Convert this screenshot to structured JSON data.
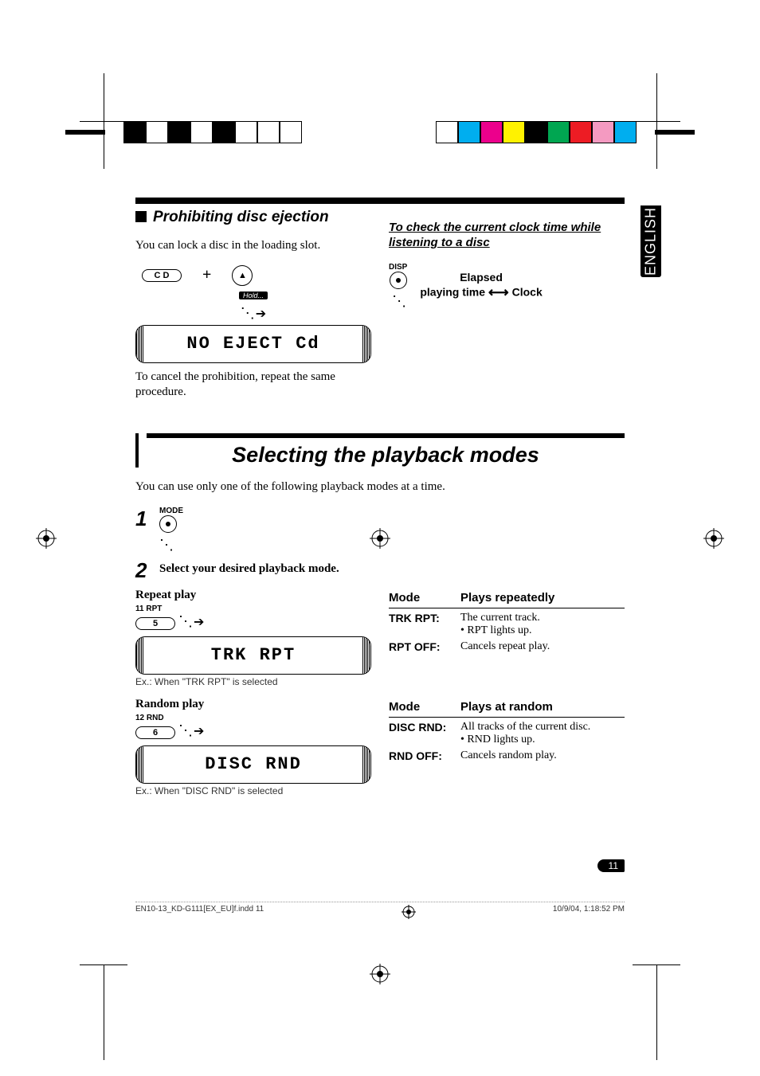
{
  "language_tab": "ENGLISH",
  "top_left": {
    "heading": "Prohibiting disc ejection",
    "line1": "You can lock a disc in the loading slot.",
    "btn_cd": "C D",
    "eject_glyph": "▲",
    "hold_chip": "Hold...",
    "lcd_text": "NO EJECT  Cd",
    "line2": "To cancel the prohibition, repeat the same procedure."
  },
  "top_right": {
    "heading": "To check the current clock time while listening to a disc",
    "disp_label": "DISP",
    "pulse1": "Elapsed",
    "pulse2_a": "playing time",
    "pulse2_b": "Clock"
  },
  "section2": {
    "title": "Selecting the playback modes",
    "lead": "You can use only one of the following playback modes at a time.",
    "step1_label": "MODE",
    "step2_text": "Select your desired playback mode.",
    "repeat": {
      "title": "Repeat play",
      "btn_small": "11   RPT",
      "btn_num": "5",
      "lcd_text": "TRK  RPT",
      "caption": "Ex.:  When \"TRK RPT\" is selected",
      "head_mode": "Mode",
      "head_desc": "Plays repeatedly",
      "r1_mode": "TRK RPT",
      "r1_desc": "The current track.",
      "r1_bullet": "• RPT lights up.",
      "r2_mode": "RPT OFF",
      "r2_desc": "Cancels repeat play."
    },
    "random": {
      "title": "Random play",
      "btn_small": "12   RND",
      "btn_num": "6",
      "lcd_text": "DISC  RND",
      "caption": "Ex.:  When \"DISC RND\" is selected",
      "head_mode": "Mode",
      "head_desc": "Plays at random",
      "r1_mode": "DISC RND",
      "r1_desc": "All tracks of the current disc.",
      "r1_bullet": "• RND        lights up.",
      "r2_mode": "RND OFF",
      "r2_desc": "Cancels random play."
    }
  },
  "page_number": "11",
  "footer": {
    "left": "EN10-13_KD-G111[EX_EU]f.indd   11",
    "right": "10/9/04, 1:18:52 PM"
  }
}
